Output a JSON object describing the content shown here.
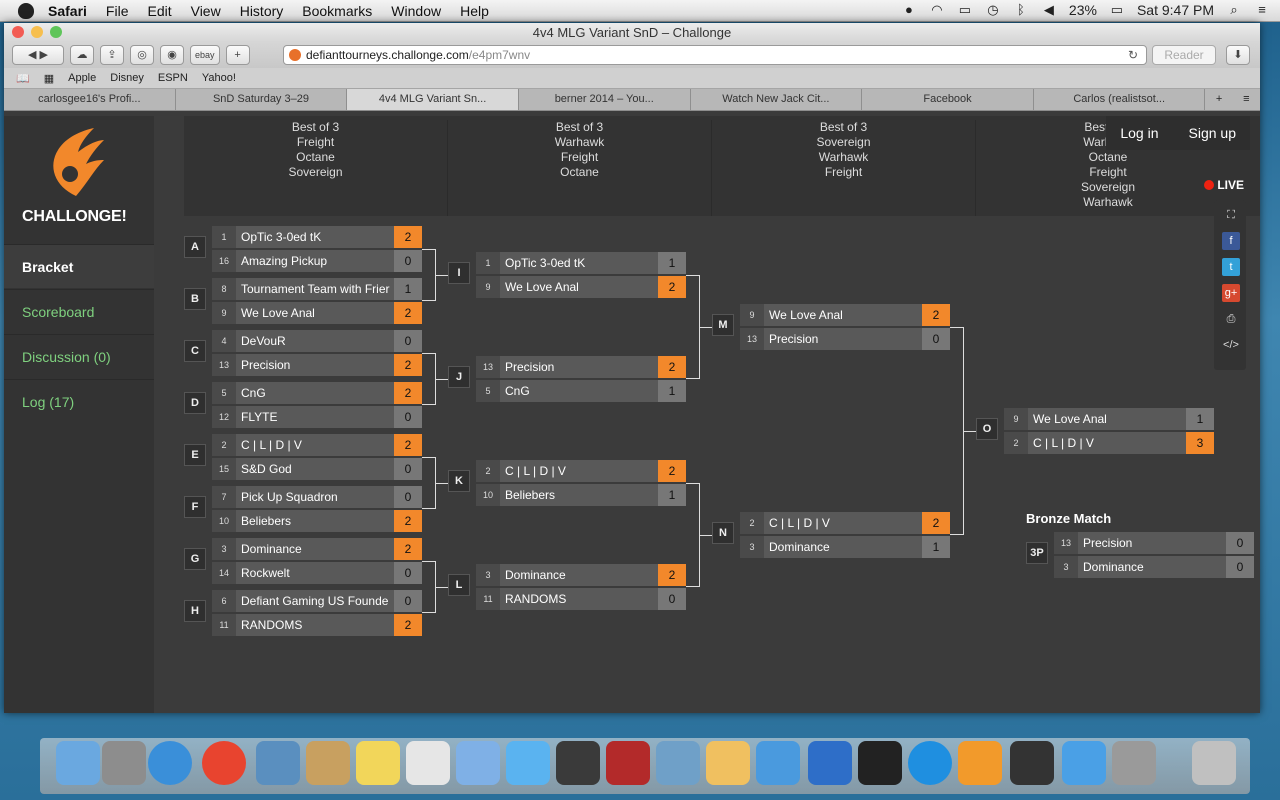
{
  "menubar": {
    "app": "Safari",
    "items": [
      "File",
      "Edit",
      "View",
      "History",
      "Bookmarks",
      "Window",
      "Help"
    ],
    "battery": "23%",
    "clock": "Sat 9:47 PM"
  },
  "window": {
    "title": "4v4 MLG Variant SnD – Challonge"
  },
  "toolbar": {
    "url_host": "defianttourneys.challonge.com",
    "url_path": "/e4pm7wnv",
    "reader": "Reader",
    "ebay": "ebay",
    "plus": "+"
  },
  "bookmarks": [
    "Apple",
    "Disney",
    "ESPN",
    "Yahoo!"
  ],
  "tabs": [
    "carlosgee16's Profi...",
    "SnD Saturday 3–29",
    "4v4 MLG Variant Sn...",
    "berner 2014 – You...",
    "Watch New Jack Cit...",
    "Facebook",
    "Carlos (realistsot..."
  ],
  "brand": {
    "name": "CHALLONGE!",
    "accent": "#f2882b"
  },
  "nav": [
    {
      "label": "Bracket"
    },
    {
      "label": "Scoreboard"
    },
    {
      "label": "Discussion (0)"
    },
    {
      "label": "Log (17)"
    }
  ],
  "auth": {
    "login": "Log in",
    "signup": "Sign up"
  },
  "live": "LIVE",
  "rounds": [
    [
      "Best of 3",
      "Freight",
      "Octane",
      "Sovereign"
    ],
    [
      "Best of 3",
      "Warhawk",
      "Freight",
      "Octane"
    ],
    [
      "Best of 3",
      "Sovereign",
      "Warhawk",
      "Freight"
    ],
    [
      "Best of 5",
      "Warhawk",
      "Octane",
      "Freight",
      "Sovereign",
      "Warhawk"
    ]
  ],
  "matches": {
    "A": {
      "p1": {
        "seed": "1",
        "name": "OpTic 3-0ed tK",
        "score": "2"
      },
      "p2": {
        "seed": "16",
        "name": "Amazing Pickup",
        "score": "0"
      }
    },
    "B": {
      "p1": {
        "seed": "8",
        "name": "Tournament Team with Frier",
        "score": "1"
      },
      "p2": {
        "seed": "9",
        "name": "We Love Anal",
        "score": "2"
      }
    },
    "C": {
      "p1": {
        "seed": "4",
        "name": "DeVouR",
        "score": "0"
      },
      "p2": {
        "seed": "13",
        "name": "Precision",
        "score": "2"
      }
    },
    "D": {
      "p1": {
        "seed": "5",
        "name": "CnG",
        "score": "2"
      },
      "p2": {
        "seed": "12",
        "name": "FLYTE",
        "score": "0"
      }
    },
    "E": {
      "p1": {
        "seed": "2",
        "name": "C | L | D | V",
        "score": "2"
      },
      "p2": {
        "seed": "15",
        "name": "S&D God",
        "score": "0"
      }
    },
    "F": {
      "p1": {
        "seed": "7",
        "name": "Pick Up Squadron",
        "score": "0"
      },
      "p2": {
        "seed": "10",
        "name": "Beliebers",
        "score": "2"
      }
    },
    "G": {
      "p1": {
        "seed": "3",
        "name": "Dominance",
        "score": "2"
      },
      "p2": {
        "seed": "14",
        "name": "Rockwelt",
        "score": "0"
      }
    },
    "H": {
      "p1": {
        "seed": "6",
        "name": "Defiant Gaming US Founde",
        "score": "0"
      },
      "p2": {
        "seed": "11",
        "name": "RANDOMS",
        "score": "2"
      }
    },
    "I": {
      "p1": {
        "seed": "1",
        "name": "OpTic 3-0ed tK",
        "score": "1"
      },
      "p2": {
        "seed": "9",
        "name": "We Love Anal",
        "score": "2"
      }
    },
    "J": {
      "p1": {
        "seed": "13",
        "name": "Precision",
        "score": "2"
      },
      "p2": {
        "seed": "5",
        "name": "CnG",
        "score": "1"
      }
    },
    "K": {
      "p1": {
        "seed": "2",
        "name": "C | L | D | V",
        "score": "2"
      },
      "p2": {
        "seed": "10",
        "name": "Beliebers",
        "score": "1"
      }
    },
    "L": {
      "p1": {
        "seed": "3",
        "name": "Dominance",
        "score": "2"
      },
      "p2": {
        "seed": "11",
        "name": "RANDOMS",
        "score": "0"
      }
    },
    "M": {
      "p1": {
        "seed": "9",
        "name": "We Love Anal",
        "score": "2"
      },
      "p2": {
        "seed": "13",
        "name": "Precision",
        "score": "0"
      }
    },
    "N": {
      "p1": {
        "seed": "2",
        "name": "C | L | D | V",
        "score": "2"
      },
      "p2": {
        "seed": "3",
        "name": "Dominance",
        "score": "1"
      }
    },
    "O": {
      "p1": {
        "seed": "9",
        "name": "We Love Anal",
        "score": "1"
      },
      "p2": {
        "seed": "2",
        "name": "C | L | D | V",
        "score": "3"
      }
    },
    "3P": {
      "p1": {
        "seed": "13",
        "name": "Precision",
        "score": "0"
      },
      "p2": {
        "seed": "3",
        "name": "Dominance",
        "score": "0"
      }
    }
  },
  "bronze_title": "Bronze Match"
}
